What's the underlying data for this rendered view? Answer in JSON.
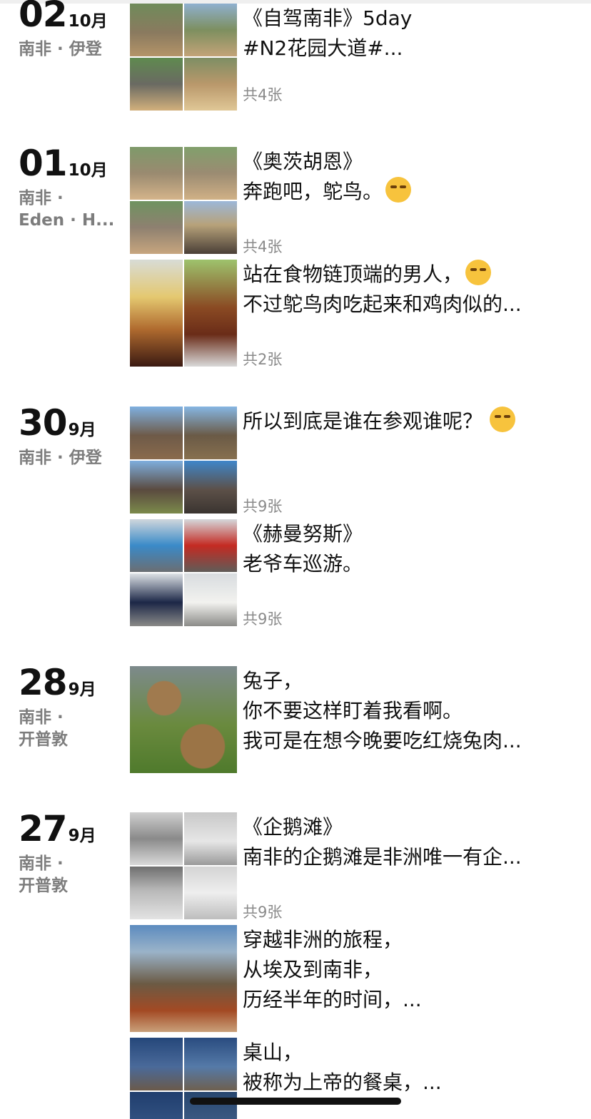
{
  "entries": [
    {
      "day": "02",
      "month": "10月",
      "loc1": "南非 · 伊登",
      "loc2": "",
      "posts": [
        {
          "line1": "《自驾南非》5day",
          "line2": "#N2花园大道#...",
          "emoji": "",
          "count": "共4张"
        }
      ]
    },
    {
      "day": "01",
      "month": "10月",
      "loc1": "南非 ·",
      "loc2": "Eden · H...",
      "posts": [
        {
          "line1": "《奥茨胡恩》",
          "line2": "奔跑吧，鸵鸟。",
          "emoji": "smirk-emoji",
          "count": "共4张"
        },
        {
          "line1": "站在食物链顶端的男人，",
          "line2": "不过鸵鸟肉吃起来和鸡肉似的...",
          "emoji": "smirk-emoji",
          "count": "共2张"
        }
      ]
    },
    {
      "day": "30",
      "month": "9月",
      "loc1": "南非 · 伊登",
      "loc2": "",
      "posts": [
        {
          "line1": "所以到底是谁在参观谁呢？",
          "line2": "",
          "emoji": "laughing-tears-emoji",
          "count": "共9张"
        },
        {
          "line1": "《赫曼努斯》",
          "line2": "老爷车巡游。",
          "emoji": "",
          "count": "共9张"
        }
      ]
    },
    {
      "day": "28",
      "month": "9月",
      "loc1": "南非 ·",
      "loc2": "开普敦",
      "posts": [
        {
          "line1": "兔子，",
          "line2": "你不要这样盯着我看啊。",
          "line3": "我可是在想今晚要吃红烧兔肉...",
          "count": ""
        }
      ]
    },
    {
      "day": "27",
      "month": "9月",
      "loc1": "南非 ·",
      "loc2": "开普敦",
      "posts": [
        {
          "line1": "《企鹅滩》",
          "line2": "南非的企鹅滩是非洲唯一有企...",
          "count": "共9张"
        },
        {
          "line1": "穿越非洲的旅程，",
          "line2": "从埃及到南非，",
          "line3": "历经半年的时间，...",
          "count": ""
        },
        {
          "line1": "桌山，",
          "line2": "被称为上帝的餐桌，...",
          "count": ""
        }
      ]
    }
  ],
  "colors": {
    "text": "#111111",
    "meta": "#8a8a8a",
    "location": "#7d7d7d"
  }
}
